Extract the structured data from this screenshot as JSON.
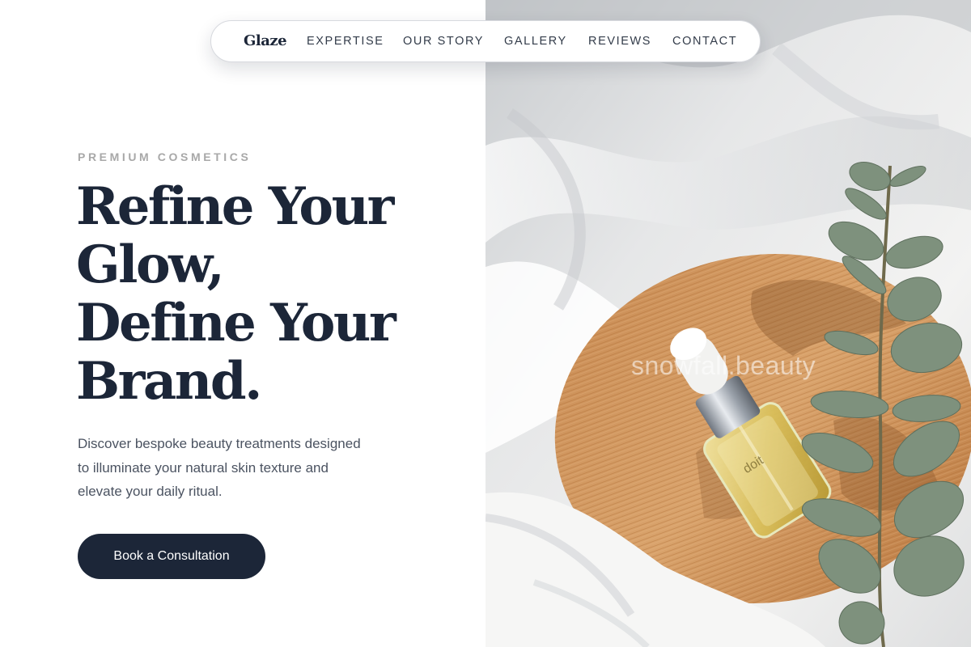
{
  "nav": {
    "logo": "Glaze",
    "links": [
      "EXPERTISE",
      "OUR STORY",
      "GALLERY",
      "REVIEWS",
      "CONTACT"
    ]
  },
  "hero": {
    "eyebrow": "PREMIUM COSMETICS",
    "headline_lines": [
      "Refine Your",
      "Glow,",
      "Define Your",
      "Brand."
    ],
    "description_lines": [
      "Discover bespoke beauty treatments designed",
      "to illuminate your natural skin texture and",
      "elevate your daily ritual."
    ],
    "cta_label": "Book a Consultation"
  },
  "image": {
    "watermark": "snowfall.beauty",
    "bottle_label": "doit"
  },
  "colors": {
    "primary": "#1c2638",
    "eyebrow": "#a8a8a8",
    "body_text": "#4b5361",
    "background": "#ffffff"
  }
}
